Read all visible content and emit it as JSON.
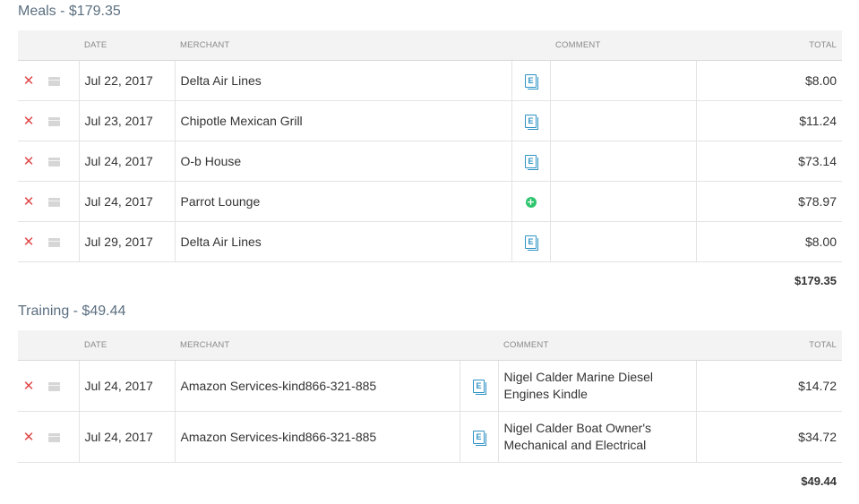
{
  "columns": {
    "date": "DATE",
    "merchant": "MERCHANT",
    "comment": "COMMENT",
    "total": "TOTAL"
  },
  "colors": {
    "delete": "#e04848",
    "receipt": "#2d92c4",
    "add": "#2fc56e",
    "title": "#5b6f80"
  },
  "sections": [
    {
      "title": "Meals - $179.35",
      "subtotal": "$179.35",
      "rows": [
        {
          "date": "Jul 22, 2017",
          "merchant": "Delta Air Lines",
          "icon": "receipt-icon",
          "comment": "",
          "total": "$8.00"
        },
        {
          "date": "Jul 23, 2017",
          "merchant": "Chipotle Mexican Grill",
          "icon": "receipt-icon",
          "comment": "",
          "total": "$11.24"
        },
        {
          "date": "Jul 24, 2017",
          "merchant": "O-b House",
          "icon": "receipt-icon",
          "comment": "",
          "total": "$73.14"
        },
        {
          "date": "Jul 24, 2017",
          "merchant": "Parrot Lounge",
          "icon": "add-receipt-icon",
          "comment": "",
          "total": "$78.97"
        },
        {
          "date": "Jul 29, 2017",
          "merchant": "Delta Air Lines",
          "icon": "receipt-icon",
          "comment": "",
          "total": "$8.00"
        }
      ]
    },
    {
      "title": "Training - $49.44",
      "subtotal": "$49.44",
      "rows": [
        {
          "date": "Jul 24, 2017",
          "merchant": "Amazon Services-kind866-321-885",
          "icon": "receipt-icon",
          "comment": "Nigel Calder Marine Diesel Engines Kindle",
          "total": "$14.72"
        },
        {
          "date": "Jul 24, 2017",
          "merchant": "Amazon Services-kind866-321-885",
          "icon": "receipt-icon",
          "comment": "Nigel Calder Boat Owner's Mechanical and Electrical",
          "total": "$34.72"
        }
      ]
    }
  ]
}
